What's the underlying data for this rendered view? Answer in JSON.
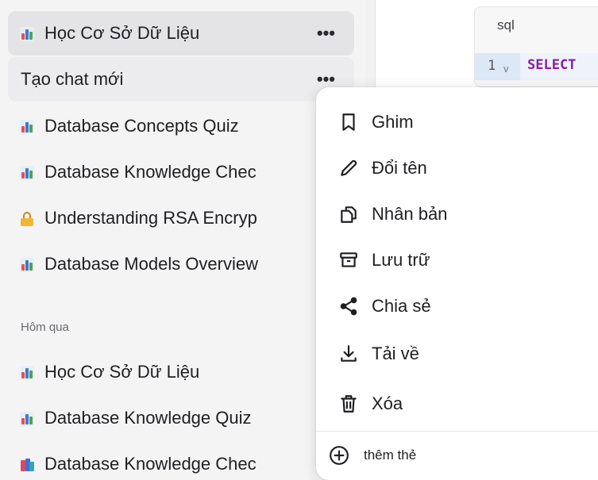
{
  "sidebar": {
    "items": [
      {
        "label": "Học Cơ Sở Dữ Liệu",
        "icon": "bar-chart-icon",
        "menu_label": "•••"
      },
      {
        "label": "Tạo chat mới",
        "menu_label": "•••"
      },
      {
        "label": "Database Concepts Quiz",
        "icon": "bar-chart-icon"
      },
      {
        "label": "Database Knowledge Chec",
        "icon": "bar-chart-icon"
      },
      {
        "label": "Understanding RSA Encryp",
        "icon": "lock-icon"
      },
      {
        "label": "Database Models Overview",
        "icon": "bar-chart-icon"
      }
    ],
    "group_yesterday": "Hôm qua",
    "yesterday_items": [
      {
        "label": "Học Cơ Sở Dữ Liệu",
        "icon": "bar-chart-icon"
      },
      {
        "label": "Database Knowledge Quiz",
        "icon": "bar-chart-icon"
      },
      {
        "label": "Database Knowledge Chec",
        "icon": "books-icon"
      }
    ]
  },
  "code": {
    "lang": "sql",
    "line_number": "1",
    "fold": "v",
    "keyword": "SELECT"
  },
  "menu": {
    "pin": "Ghim",
    "rename": "Đổi tên",
    "duplicate": "Nhân bản",
    "archive": "Lưu trữ",
    "share": "Chia sẻ",
    "download": "Tải về",
    "delete": "Xóa",
    "add_tag": "thêm thẻ"
  },
  "colors": {
    "sidebar_bg": "#f4f4f5",
    "active_item_bg": "#e4e4e6",
    "keyword": "#8a1ea3"
  }
}
